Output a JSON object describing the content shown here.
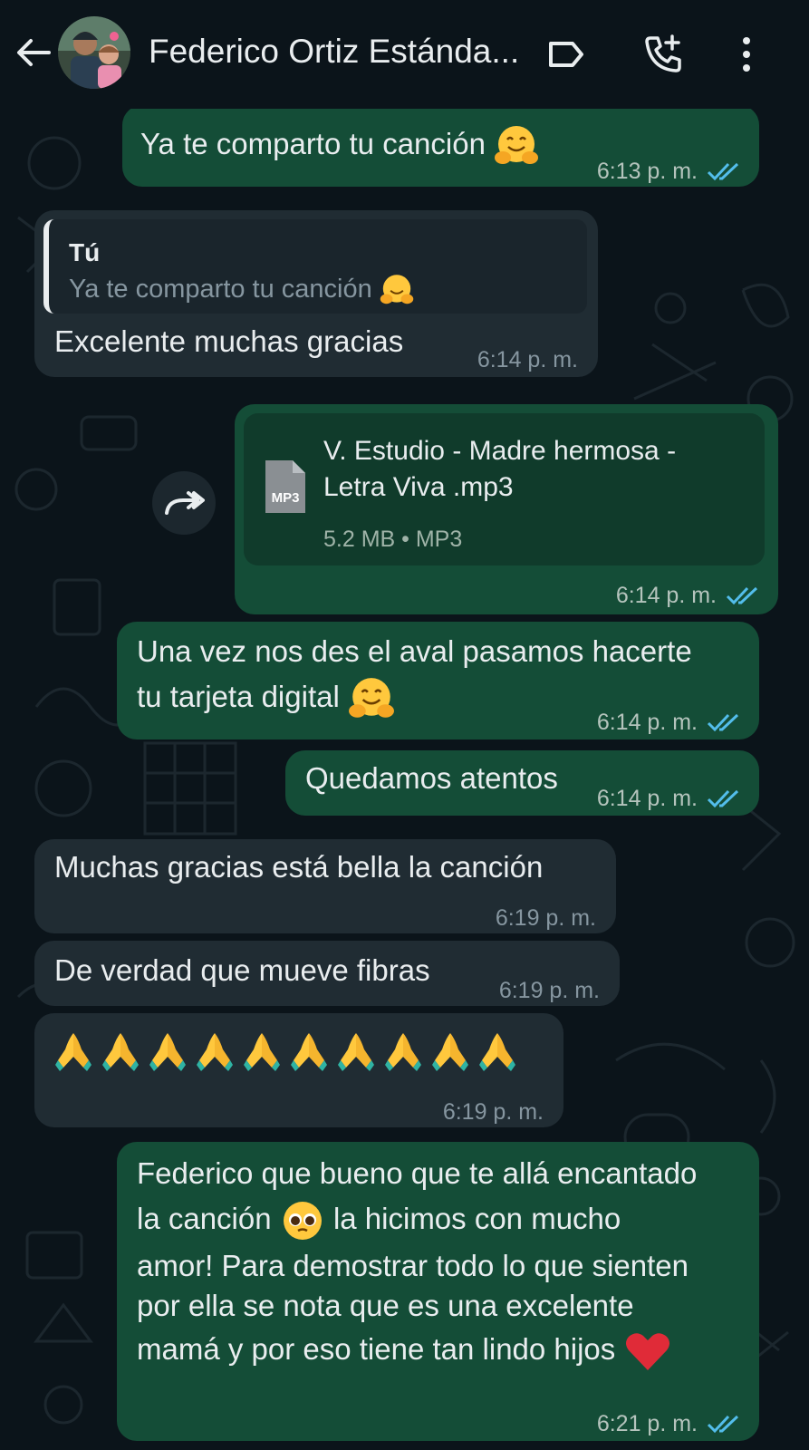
{
  "header": {
    "contact_name": "Federico Ortiz Estánda...",
    "icons": [
      "back-arrow-icon",
      "label-icon",
      "add-call-icon",
      "more-vert-icon"
    ]
  },
  "colors": {
    "background": "#0b141a",
    "outgoing_bubble": "#144d37",
    "incoming_bubble": "#202c33",
    "read_ticks": "#53bdeb"
  },
  "messages": [
    {
      "dir": "out",
      "text": "Ya te comparto tu canción",
      "emoji": "hugging-face",
      "time": "6:13 p. m.",
      "status": "read"
    },
    {
      "dir": "in",
      "quote_author": "Tú",
      "quote_text": "Ya te comparto tu canción",
      "text": "Excelente muchas gracias",
      "time": "6:14 p. m."
    },
    {
      "dir": "out",
      "file_type_badge": "MP3",
      "file_name_line1": "V. Estudio - Madre hermosa -",
      "file_name_line2": "Letra Viva  .mp3",
      "file_meta": "5.2 MB • MP3",
      "time": "6:14 p. m.",
      "status": "read"
    },
    {
      "dir": "out",
      "line1": "Una vez nos des el aval pasamos hacerte",
      "line2": "tu tarjeta digital",
      "emoji": "hugging-face",
      "time": "6:14 p. m.",
      "status": "read"
    },
    {
      "dir": "out",
      "text": "Quedamos atentos",
      "time": "6:14 p. m.",
      "status": "read"
    },
    {
      "dir": "in",
      "text": "Muchas gracias está bella la canción",
      "time": "6:19 p. m."
    },
    {
      "dir": "in",
      "text": "De verdad que mueve fibras",
      "time": "6:19 p. m."
    },
    {
      "dir": "in",
      "emoji": "folded-hands x10",
      "time": "6:19 p. m."
    },
    {
      "dir": "out",
      "lines": [
        "Federico que bueno que te allá encantado",
        "la canción",
        "la hicimos con mucho",
        "amor! Para demostrar todo lo que sienten",
        "por ella se nota que es una excelente",
        "mamá y por eso tiene tan lindo hijos"
      ],
      "emojis": [
        "pleading-face",
        "red-heart"
      ],
      "time": "6:21 p. m.",
      "status": "read"
    }
  ]
}
